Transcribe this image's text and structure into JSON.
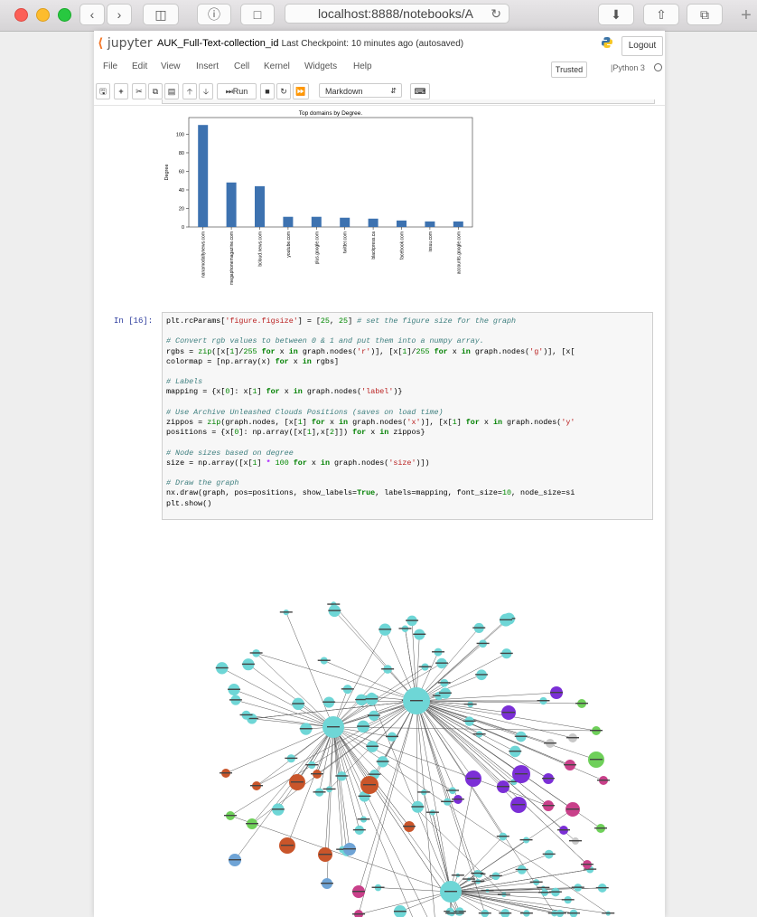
{
  "browser": {
    "url": "localhost:8888/notebooks/A",
    "back_icon": "chevron-left-icon",
    "forward_icon": "chevron-right-icon"
  },
  "header": {
    "logo_text": "jupyter",
    "notebook_name": "AUK_Full-Text-collection_id",
    "checkpoint": "Last Checkpoint: 10 minutes ago",
    "autosave": "(autosaved)",
    "logout_label": "Logout"
  },
  "menu": [
    "File",
    "Edit",
    "View",
    "Insert",
    "Cell",
    "Kernel",
    "Widgets",
    "Help"
  ],
  "trusted_label": "Trusted",
  "kernel_name": "Python 3",
  "toolbar": {
    "run_label": "Run",
    "cell_type": "Markdown"
  },
  "chart_data": {
    "type": "bar",
    "title": "Top domains by Degree.",
    "ylabel": "Degree",
    "xlabel": "",
    "categories": [
      "nanamodaltynews.com",
      "megaphonemagazine.com",
      "bcloud.news.com",
      "youtube.com",
      "plus.google.com",
      "twitter.com",
      "blackpress.ca",
      "facebook.com",
      "issuu.com",
      "accounts.google.com"
    ],
    "values": [
      110,
      48,
      44,
      11,
      11,
      10,
      9,
      7,
      6,
      6
    ],
    "ylim": [
      0,
      118
    ],
    "yticks": [
      0,
      20,
      40,
      60,
      80,
      100
    ],
    "color": "#3d72b0"
  },
  "cell": {
    "prompt": "In [16]:",
    "lines": [
      "plt.rcParams['figure.figsize'] = [25, 25] # set the figure size for the graph",
      "",
      "# Convert rgb values to between 0 & 1 and put them into a numpy array.",
      "rgbs = zip([x[1]/255 for x in graph.nodes('r')], [x[1]/255 for x in graph.nodes('g')], [x[",
      "colormap = [np.array(x) for x in rgbs]",
      "",
      "# Labels",
      "mapping = {x[0]: x[1] for x in graph.nodes('label')}",
      "",
      "# Use Archive Unleashed Clouds Positions (saves on load time)",
      "zippos = zip(graph.nodes, [x[1] for x in graph.nodes('x')], [x[1] for x in graph.nodes('y'",
      "positions = {x[0]: np.array([x[1],x[2]]) for x in zippos}",
      "",
      "# Node sizes based on degree",
      "size = np.array([x[1] * 100 for x in graph.nodes('size')])",
      "",
      "# Draw the graph",
      "nx.draw(graph, pos=positions, show_labels=True, labels=mapping, font_size=10, node_size=si",
      "plt.show()"
    ]
  },
  "graph_colors": {
    "teal": "#6ed6d6",
    "purple": "#7b2fd6",
    "orange": "#c9552a",
    "pink": "#c9408a",
    "green": "#6fd05a",
    "grey": "#c8c8c8",
    "blue": "#6fa4d6"
  }
}
